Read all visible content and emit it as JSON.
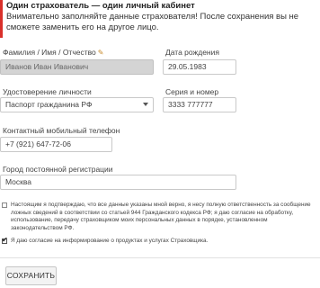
{
  "notice": {
    "title": "Один страхователь — один личный кабинет",
    "text": "Внимательно заполняйте данные страхователя! После сохранения вы не сможете заменить его на другое лицо."
  },
  "form": {
    "full_name": {
      "label": "Фамилия / Имя / Отчество",
      "value": "Иванов Иван Иванович",
      "icon": "pencil-icon"
    },
    "birth_date": {
      "label": "Дата рождения",
      "value": "29.05.1983"
    },
    "id_document": {
      "label": "Удостоверение личности",
      "value": "Паспорт гражданина РФ"
    },
    "series_number": {
      "label": "Серия и номер",
      "value": "3333 777777"
    },
    "phone": {
      "label": "Контактный мобильный телефон",
      "value": "+7 (921) 647-72-06"
    },
    "city": {
      "label": "Город постоянной регистрации",
      "value": "Москва"
    }
  },
  "consents": {
    "data_accuracy": {
      "checked": false,
      "line1": "Настоящим я подтверждаю, что все данные указаны мной верно, я несу полную ответственность за сообщение",
      "line2": "ложных сведений в соответствии со статьей 944 Гражданского кодекса РФ; я даю согласие на обработку,",
      "line3": "использование, передачу страховщиком моих персональных данных в порядке, установленном",
      "line4": "законодательством РФ."
    },
    "marketing": {
      "checked": true,
      "text": "Я даю согласие на информирование о продуктах и услугах Страховщика."
    }
  },
  "actions": {
    "save_label": "СОХРАНИТЬ"
  },
  "colors": {
    "accent_red": "#d9302b",
    "disabled_field": "#d4d4d4"
  }
}
